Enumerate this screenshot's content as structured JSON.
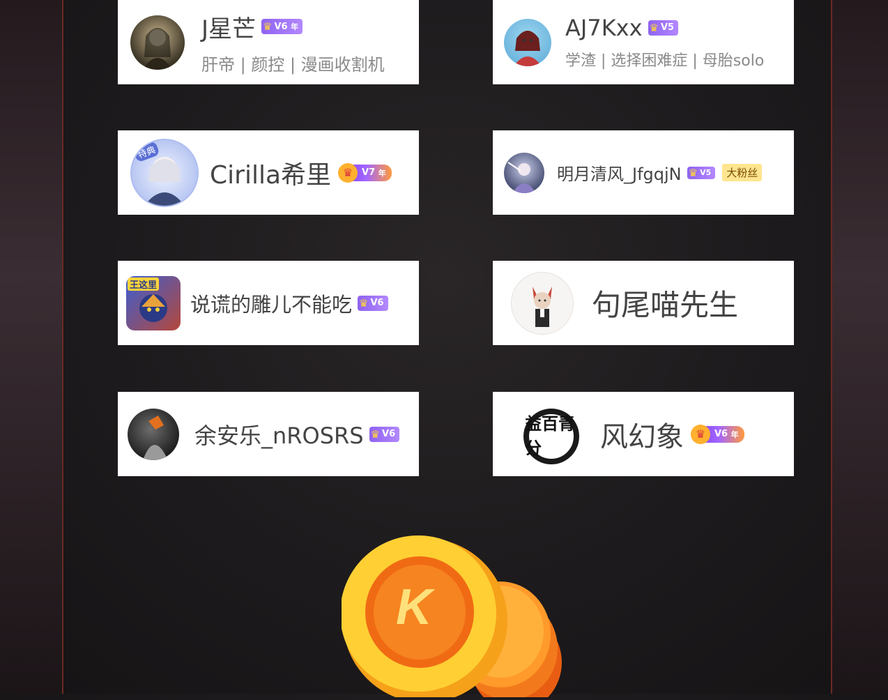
{
  "users": [
    {
      "name": "J星芒",
      "level": "V6",
      "annual": "年",
      "bio": "肝帝 | 颜控 | 漫画收割机",
      "avatar": "anime-avatar-icon"
    },
    {
      "name": "AJ7Kxx",
      "level": "V5",
      "annual": "",
      "bio": "学渣 | 选择困难症 | 母胎solo",
      "avatar": "anime-avatar-icon"
    },
    {
      "name": "Cirilla希里",
      "level": "V7",
      "annual": "年",
      "bio": "",
      "avatar": "anime-avatar-icon",
      "avatar_tag": "特典"
    },
    {
      "name": "明月清风_JfgqjN",
      "level": "V5",
      "annual": "",
      "bio": "",
      "avatar": "anime-avatar-icon",
      "fan_badge": "大粉丝"
    },
    {
      "name": "说谎的雕儿不能吃",
      "level": "V6",
      "annual": "",
      "bio": "",
      "avatar": "game-avatar-icon",
      "avatar_tag": "王这里"
    },
    {
      "name": "句尾喵先生",
      "level": "",
      "annual": "",
      "bio": "",
      "avatar": "cat-avatar-icon"
    },
    {
      "name": "余安乐_nROSRS",
      "level": "V6",
      "annual": "",
      "bio": "",
      "avatar": "photo-avatar-icon"
    },
    {
      "name": "风幻象",
      "level": "V6",
      "annual": "年",
      "bio": "",
      "avatar": "calligraphy-avatar-icon",
      "avatar_chars": "益百青分"
    }
  ],
  "coin_letter": "K",
  "colors": {
    "card_bg": "#ffffff",
    "badge_purple": "#8f63f0",
    "coin_orange": "#f27b1a",
    "coin_yellow": "#ffc62b",
    "frame_red": "#6b2a22"
  }
}
